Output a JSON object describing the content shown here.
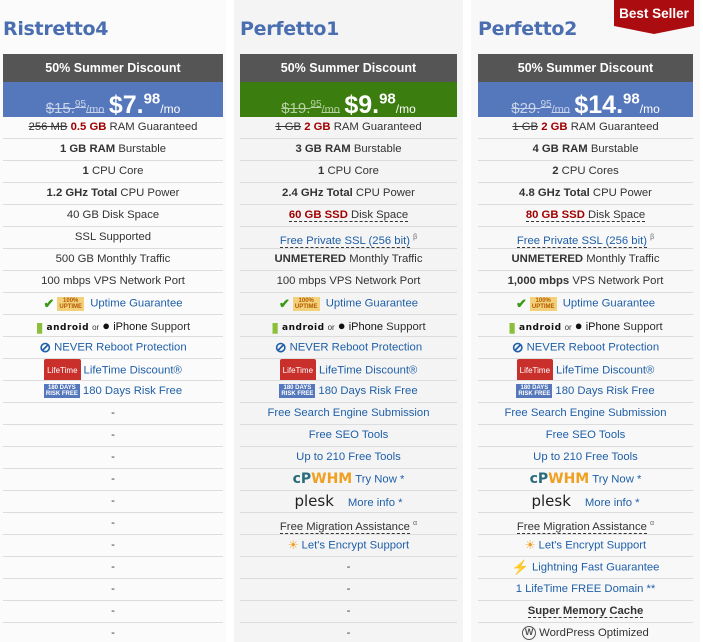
{
  "ribbon": {
    "label": "Best Seller",
    "color": "#aa0c10"
  },
  "colors": {
    "blue_price": "#5577bb",
    "green_price": "#3c7d10",
    "discount_bar": "#555555",
    "title": "#4a6eb0",
    "link": "#1f5fa8",
    "highlight_red": "#a00000"
  },
  "plans": [
    {
      "name": "Ristretto4",
      "discount": "50% Summer Discount",
      "old_price_main": "$15.",
      "old_price_cents": "95",
      "old_price_unit": "/mo",
      "new_price_main": "$7.",
      "new_price_cents": "98",
      "new_price_unit": "/mo",
      "ram_old": "256 MB",
      "ram_new": "0.5 GB",
      "ram_suffix": "RAM Guaranteed",
      "burst_bold": "1 GB RAM",
      "burst_rest": "Burstable",
      "cpu_bold": "1",
      "cpu_rest": "CPU Core",
      "power_bold": "1.2 GHz Total",
      "power_rest": "CPU Power",
      "disk": "40 GB Disk Space",
      "ssl": "SSL Supported",
      "traffic": "500 GB Monthly Traffic",
      "port": "100 mbps VPS Network Port",
      "uptime": "Uptime Guarantee",
      "mobile_or": "or",
      "mobile_iphone": "iPhone",
      "mobile_support": "Support",
      "android_text": "android",
      "reboot": "NEVER Reboot Protection",
      "lifetime_badge": "LifeTime",
      "lifetime": "LifeTime Discount®",
      "risk_badge_top": "180 DAYS",
      "risk_badge_bottom": "RISK FREE",
      "risk": "180 Days Risk Free",
      "dashes": [
        "-",
        "-",
        "-",
        "-",
        "-",
        "-",
        "-",
        "-",
        "-",
        "-",
        "-"
      ]
    },
    {
      "name": "Perfetto1",
      "discount": "50% Summer Discount",
      "old_price_main": "$19.",
      "old_price_cents": "95",
      "old_price_unit": "/mo",
      "new_price_main": "$9.",
      "new_price_cents": "98",
      "new_price_unit": "/mo",
      "ram_old": "1 GB",
      "ram_new": "2 GB",
      "ram_suffix": "RAM Guaranteed",
      "burst_bold": "3 GB RAM",
      "burst_rest": "Burstable",
      "cpu_bold": "1",
      "cpu_rest": "CPU Core",
      "power_bold": "2.4 GHz Total",
      "power_rest": "CPU Power",
      "disk_bold": "60 GB SSD",
      "disk_rest": "Disk Space",
      "ssl": "Free Private SSL (256 bit)",
      "ssl_mark": "β",
      "traffic_bold": "UNMETERED",
      "traffic_rest": "Monthly Traffic",
      "port": "100 mbps VPS Network Port",
      "uptime": "Uptime Guarantee",
      "mobile_or": "or",
      "mobile_iphone": "iPhone",
      "mobile_support": "Support",
      "android_text": "android",
      "reboot": "NEVER Reboot Protection",
      "lifetime_badge": "LifeTime",
      "lifetime": "LifeTime Discount®",
      "risk_badge_top": "180 DAYS",
      "risk_badge_bottom": "RISK FREE",
      "risk": "180 Days Risk Free",
      "seo_submit": "Free Search Engine Submission",
      "seo_tools": "Free SEO Tools",
      "free_tools": "Up to 210 Free Tools",
      "whm_cp": "cP",
      "whm_logo": "WHM",
      "whm_link": "Try Now *",
      "plesk_logo": "plesk",
      "plesk_link": "More info *",
      "migration": "Free Migration Assistance",
      "migration_mark": "α",
      "letsencrypt": "Let's Encrypt Support",
      "dashes": [
        "-",
        "-",
        "-",
        "-"
      ]
    },
    {
      "name": "Perfetto2",
      "discount": "50% Summer Discount",
      "old_price_main": "$29.",
      "old_price_cents": "95",
      "old_price_unit": "/mo",
      "new_price_main": "$14.",
      "new_price_cents": "98",
      "new_price_unit": "/mo",
      "ram_old": "1 GB",
      "ram_new": "2 GB",
      "ram_suffix": "RAM Guaranteed",
      "burst_bold": "4 GB RAM",
      "burst_rest": "Burstable",
      "cpu_bold": "2",
      "cpu_rest": "CPU Cores",
      "power_bold": "4.8 GHz Total",
      "power_rest": "CPU Power",
      "disk_bold": "80 GB SSD",
      "disk_rest": "Disk Space",
      "ssl": "Free Private SSL (256 bit)",
      "ssl_mark": "β",
      "traffic_bold": "UNMETERED",
      "traffic_rest": "Monthly Traffic",
      "port_bold": "1,000 mbps",
      "port_rest": "VPS Network Port",
      "uptime": "Uptime Guarantee",
      "mobile_or": "or",
      "mobile_iphone": "iPhone",
      "mobile_support": "Support",
      "android_text": "android",
      "reboot": "NEVER Reboot Protection",
      "lifetime_badge": "LifeTime",
      "lifetime": "LifeTime Discount®",
      "risk_badge_top": "180 DAYS",
      "risk_badge_bottom": "RISK FREE",
      "risk": "180 Days Risk Free",
      "seo_submit": "Free Search Engine Submission",
      "seo_tools": "Free SEO Tools",
      "free_tools": "Up to 210 Free Tools",
      "whm_cp": "cP",
      "whm_logo": "WHM",
      "whm_link": "Try Now *",
      "plesk_logo": "plesk",
      "plesk_link": "More info *",
      "migration": "Free Migration Assistance",
      "migration_mark": "α",
      "letsencrypt": "Let's Encrypt Support",
      "lightning": "Lightning Fast Guarantee",
      "free_domain": "1 LifeTime FREE Domain **",
      "memory_cache": "Super Memory Cache",
      "wordpress": "WordPress Optimized"
    }
  ]
}
